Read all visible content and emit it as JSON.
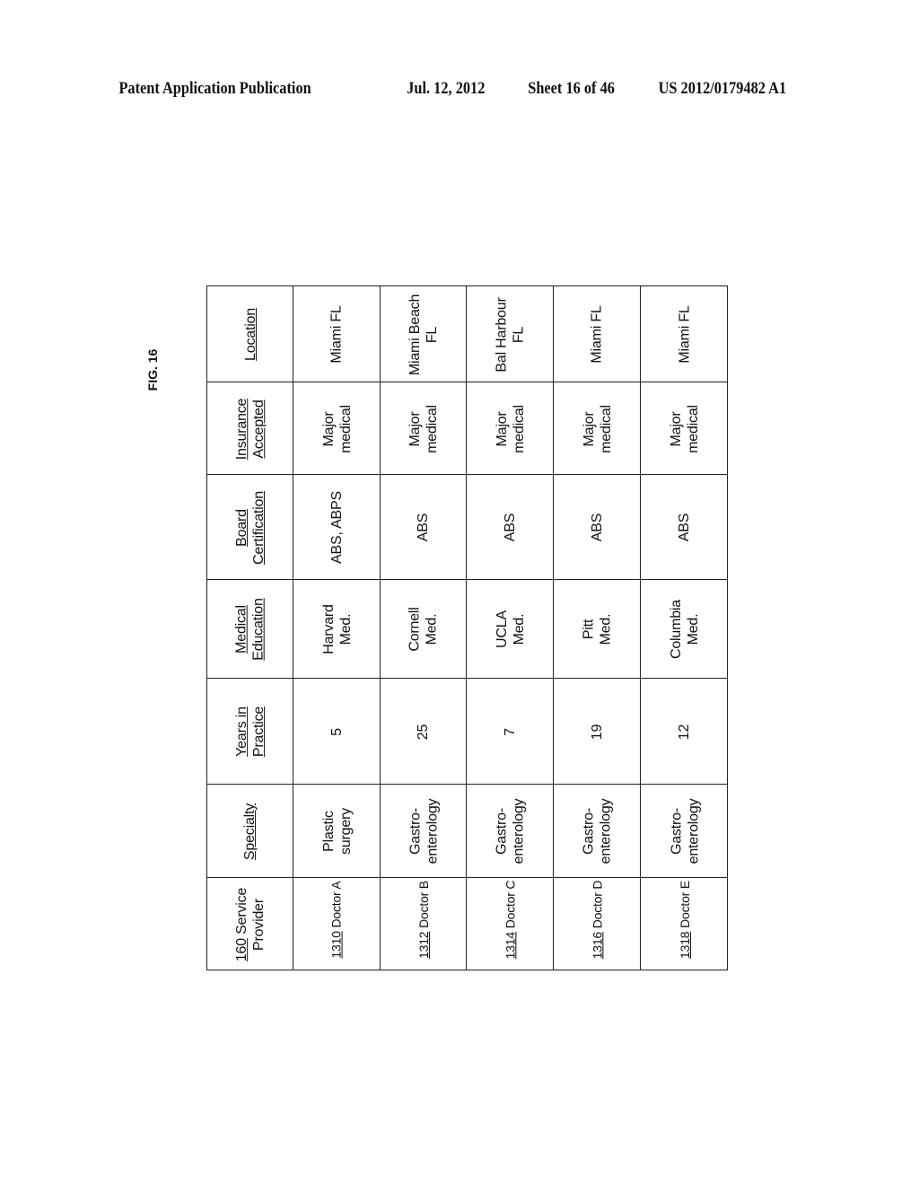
{
  "header": {
    "publication": "Patent Application Publication",
    "date": "Jul. 12, 2012",
    "sheet": "Sheet 16 of 46",
    "number": "US 2012/0179482 A1"
  },
  "figure": {
    "label": "FIG. 16"
  },
  "table": {
    "headers": {
      "provider_ref": "160",
      "provider_label": " Service\nProvider",
      "specialty": "Specialty",
      "years": "Years in\nPractice",
      "education": "Medical\nEducation",
      "certification": "Board\nCertification",
      "insurance": "Insurance\nAccepted",
      "location": "Location"
    },
    "rows": [
      {
        "ref": "1310",
        "provider": " Doctor A",
        "specialty": "Plastic\nsurgery",
        "years": "5",
        "education": "Harvard\nMed.",
        "certification": "ABS, ABPS",
        "insurance": "Major\nmedical",
        "location": "Miami FL"
      },
      {
        "ref": "1312",
        "provider": " Doctor B",
        "specialty": "Gastro-\nenterology",
        "years": "25",
        "education": "Cornell\nMed.",
        "certification": "ABS",
        "insurance": "Major\nmedical",
        "location": "Miami Beach\nFL"
      },
      {
        "ref": "1314",
        "provider": " Doctor C",
        "specialty": "Gastro-\nenterology",
        "years": "7",
        "education": "UCLA\nMed.",
        "certification": "ABS",
        "insurance": "Major\nmedical",
        "location": "Bal Harbour\nFL"
      },
      {
        "ref": "1316",
        "provider": " Doctor D",
        "specialty": "Gastro-\nenterology",
        "years": "19",
        "education": "Pitt\nMed.",
        "certification": "ABS",
        "insurance": "Major\nmedical",
        "location": "Miami FL"
      },
      {
        "ref": "1318",
        "provider": " Doctor E",
        "specialty": "Gastro-\nenterology",
        "years": "12",
        "education": "Columbia\nMed.",
        "certification": "ABS",
        "insurance": "Major\nmedical",
        "location": "Miami FL"
      }
    ]
  }
}
